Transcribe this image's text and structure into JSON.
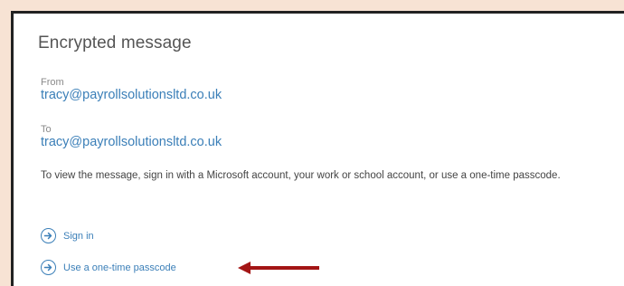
{
  "message": {
    "title": "Encrypted message",
    "from_label": "From",
    "from_email": "tracy@payrollsolutionsltd.co.uk",
    "to_label": "To",
    "to_email": "tracy@payrollsolutionsltd.co.uk",
    "instructions": "To view the message, sign in with a Microsoft account, your work or school account, or use a one-time passcode."
  },
  "actions": [
    {
      "label": "Sign in",
      "icon": "arrow-right-circle-icon"
    },
    {
      "label": "Use a one-time passcode",
      "icon": "arrow-right-circle-icon"
    }
  ],
  "colors": {
    "link": "#3b7fb8",
    "title": "#555555",
    "background": "#f7e3d4",
    "annotation_arrow": "#a31515"
  }
}
